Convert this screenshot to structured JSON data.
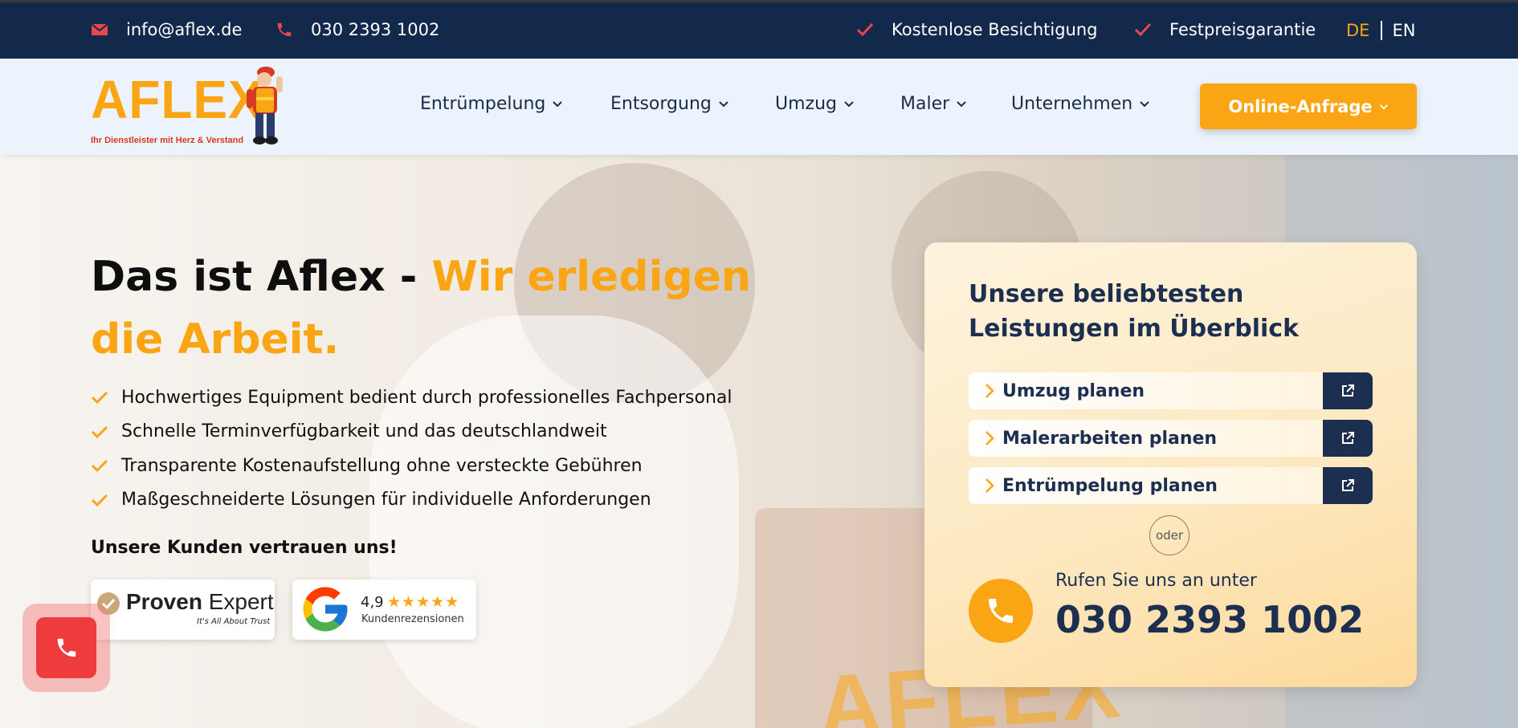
{
  "topbar": {
    "email": "info@aflex.de",
    "phone": "030 2393 1002",
    "features": [
      "Kostenlose Besichtigung",
      "Festpreisgarantie"
    ],
    "languages": [
      "DE",
      "EN"
    ],
    "active_language": "DE"
  },
  "header": {
    "logo_word": "AFLEX",
    "logo_tagline": "Ihr Dienstleister mit Herz & Verstand",
    "nav": [
      "Entrümpelung",
      "Entsorgung",
      "Umzug",
      "Maler",
      "Unternehmen"
    ],
    "cta_label": "Online-Anfrage"
  },
  "hero": {
    "headline_plain": "Das ist Aflex - ",
    "headline_accent": "Wir erledigen die Arbeit.",
    "bullets": [
      "Hochwertiges Equipment bedient durch professionelles Fachpersonal",
      "Schnelle Terminverfügbarkeit und das deutschlandweit",
      "Transparente Kostenaufstellung ohne versteckte Gebühren",
      "Maßgeschneiderte Lösungen für individuelle Anforderungen"
    ],
    "trust_heading": "Unsere Kunden vertrauen uns!",
    "proven_expert": {
      "name_bold": "Proven",
      "name_light": "Expert",
      "tagline": "It's All About Trust"
    },
    "google": {
      "rating": "4,9",
      "stars": "★★★★★",
      "label": "Kundenrezensionen"
    },
    "background_text": "AFLEX"
  },
  "card": {
    "title": "Unsere beliebtesten Leistungen im Überblick",
    "services": [
      "Umzug planen",
      "Malerarbeiten planen",
      "Entrümpelung planen"
    ],
    "separator": "oder",
    "call_label": "Rufen Sie uns an unter",
    "call_number": "030 2393 1002"
  },
  "colors": {
    "navy": "#13294b",
    "accent": "#f9a514",
    "card_text": "#1d2f50",
    "alert_red": "#ee3b3b"
  },
  "icons": {
    "email": "envelope-icon",
    "phone": "phone-icon",
    "check": "check-icon",
    "chevron": "chevron-down-icon",
    "external": "external-link-icon"
  }
}
